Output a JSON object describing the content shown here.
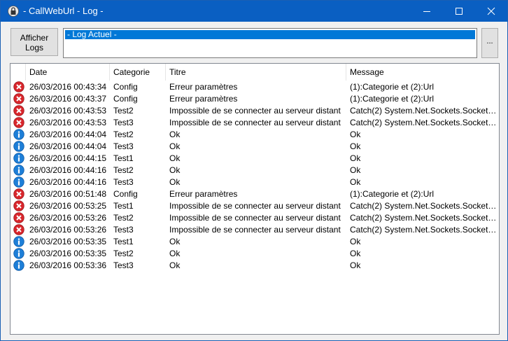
{
  "window": {
    "title": "- CallWebUrl - Log -"
  },
  "toolbar": {
    "afficher_line1": "Afficher",
    "afficher_line2": "Logs",
    "log_selected": "- Log Actuel -",
    "dots_label": "..."
  },
  "columns": [
    "",
    "Date",
    "Categorie",
    "Titre",
    "Message"
  ],
  "rows": [
    {
      "icon": "error-icon",
      "date": "26/03/2016 00:43:34",
      "cat": "Config",
      "title": "Erreur paramètres",
      "msg": "(1):Categorie et (2):Url"
    },
    {
      "icon": "error-icon",
      "date": "26/03/2016 00:43:37",
      "cat": "Config",
      "title": "Erreur paramètres",
      "msg": "(1):Categorie et (2):Url"
    },
    {
      "icon": "error-icon",
      "date": "26/03/2016 00:43:53",
      "cat": "Test2",
      "title": "Impossible de se connecter au serveur distant",
      "msg": "Catch(2) System.Net.Sockets.SocketEx..."
    },
    {
      "icon": "error-icon",
      "date": "26/03/2016 00:43:53",
      "cat": "Test3",
      "title": "Impossible de se connecter au serveur distant",
      "msg": "Catch(2) System.Net.Sockets.SocketEx..."
    },
    {
      "icon": "info-icon",
      "date": "26/03/2016 00:44:04",
      "cat": "Test2",
      "title": "Ok",
      "msg": "Ok"
    },
    {
      "icon": "info-icon",
      "date": "26/03/2016 00:44:04",
      "cat": "Test3",
      "title": "Ok",
      "msg": "Ok"
    },
    {
      "icon": "info-icon",
      "date": "26/03/2016 00:44:15",
      "cat": "Test1",
      "title": "Ok",
      "msg": "Ok"
    },
    {
      "icon": "info-icon",
      "date": "26/03/2016 00:44:16",
      "cat": "Test2",
      "title": "Ok",
      "msg": "Ok"
    },
    {
      "icon": "info-icon",
      "date": "26/03/2016 00:44:16",
      "cat": "Test3",
      "title": "Ok",
      "msg": "Ok"
    },
    {
      "icon": "error-icon",
      "date": "26/03/2016 00:51:48",
      "cat": "Config",
      "title": "Erreur paramètres",
      "msg": "(1):Categorie et (2):Url"
    },
    {
      "icon": "error-icon",
      "date": "26/03/2016 00:53:25",
      "cat": "Test1",
      "title": "Impossible de se connecter au serveur distant",
      "msg": "Catch(2) System.Net.Sockets.SocketEx..."
    },
    {
      "icon": "error-icon",
      "date": "26/03/2016 00:53:26",
      "cat": "Test2",
      "title": "Impossible de se connecter au serveur distant",
      "msg": "Catch(2) System.Net.Sockets.SocketEx..."
    },
    {
      "icon": "error-icon",
      "date": "26/03/2016 00:53:26",
      "cat": "Test3",
      "title": "Impossible de se connecter au serveur distant",
      "msg": "Catch(2) System.Net.Sockets.SocketEx..."
    },
    {
      "icon": "info-icon",
      "date": "26/03/2016 00:53:35",
      "cat": "Test1",
      "title": "Ok",
      "msg": "Ok"
    },
    {
      "icon": "info-icon",
      "date": "26/03/2016 00:53:35",
      "cat": "Test2",
      "title": "Ok",
      "msg": "Ok"
    },
    {
      "icon": "info-icon",
      "date": "26/03/2016 00:53:36",
      "cat": "Test3",
      "title": "Ok",
      "msg": "Ok"
    }
  ],
  "colors": {
    "titlebar": "#0a5fc2",
    "selection": "#0078d7",
    "error": "#d9262c",
    "info": "#1e7fd8"
  }
}
